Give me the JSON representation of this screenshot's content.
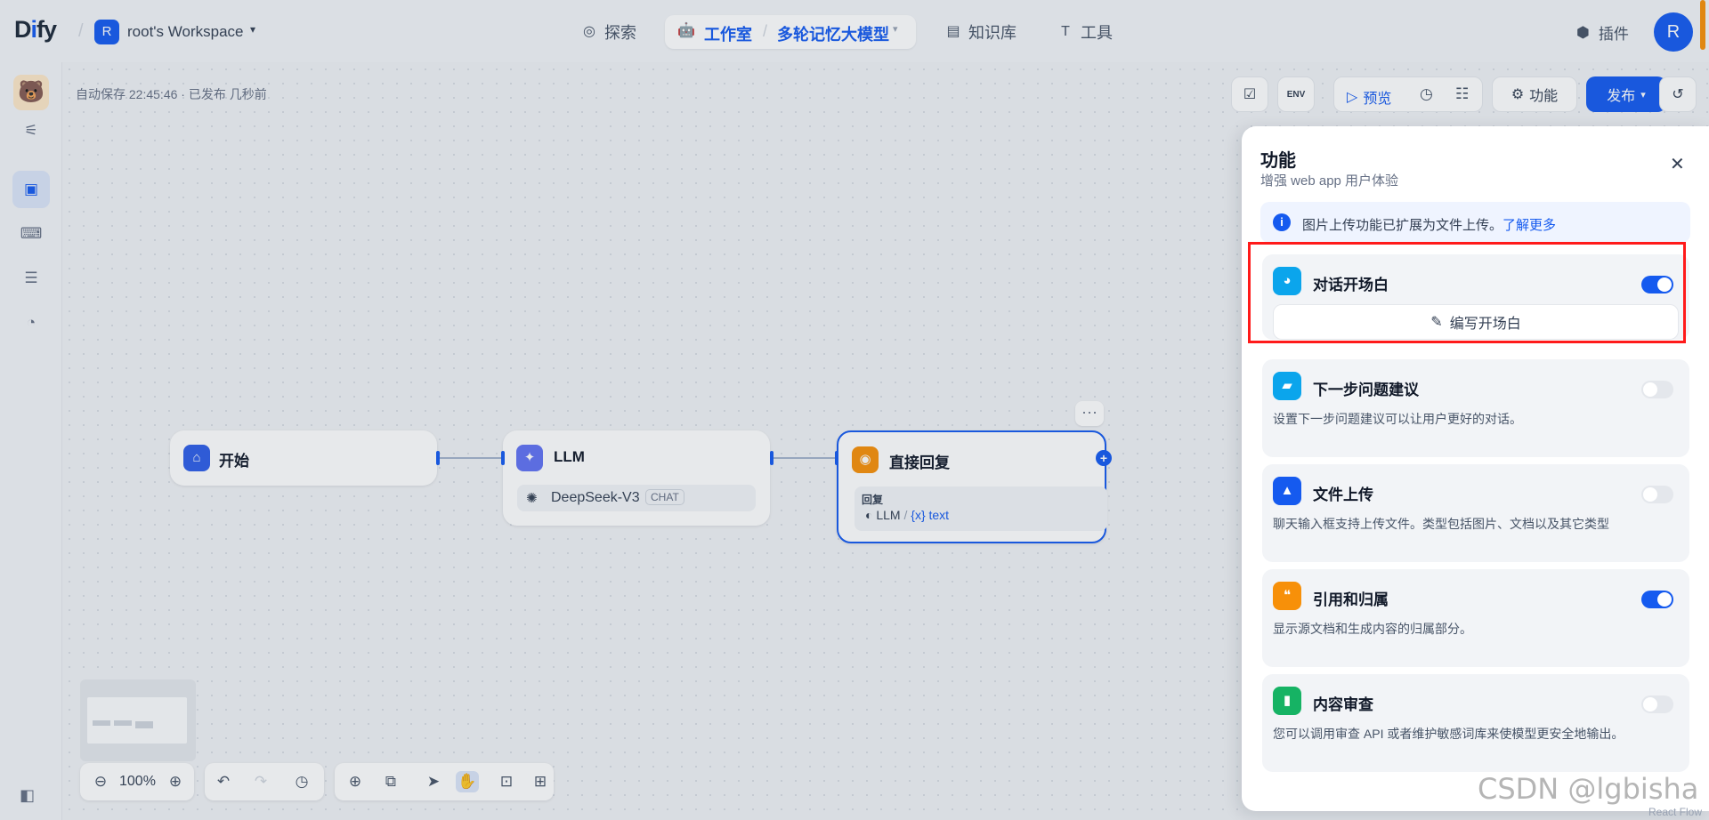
{
  "header": {
    "logo_main": "D",
    "logo_i": "i",
    "logo_rest": "fy",
    "workspace_initial": "R",
    "workspace_name": "root's Workspace",
    "nav": {
      "explore": "探索",
      "studio": "工作室",
      "app_name": "多轮记忆大模型",
      "knowledge": "知识库",
      "tools": "工具"
    },
    "plugins": "插件",
    "user_initial": "R"
  },
  "canvas": {
    "autosave": "自动保存 22:45:46 · 已发布 几秒前",
    "toolbar": {
      "preview": "预览",
      "features": "功能",
      "publish": "发布",
      "env": "ENV"
    },
    "zoom": "100%"
  },
  "nodes": {
    "start": {
      "title": "开始"
    },
    "llm": {
      "title": "LLM",
      "model": "DeepSeek-V3",
      "mode_tag": "CHAT"
    },
    "answer": {
      "title": "直接回复",
      "reply_label": "回复",
      "var_node": "LLM",
      "var_sep": "/",
      "var_name": "{x} text"
    }
  },
  "panel": {
    "title": "功能",
    "subtitle": "增强 web app 用户体验",
    "info": "图片上传功能已扩展为文件上传。",
    "info_link": "了解更多",
    "features": [
      {
        "title": "对话开场白",
        "enabled": true,
        "action": "编写开场白"
      },
      {
        "title": "下一步问题建议",
        "enabled": false,
        "desc": "设置下一步问题建议可以让用户更好的对话。"
      },
      {
        "title": "文件上传",
        "enabled": false,
        "desc": "聊天输入框支持上传文件。类型包括图片、文档以及其它类型"
      },
      {
        "title": "引用和归属",
        "enabled": true,
        "desc": "显示源文档和生成内容的归属部分。"
      },
      {
        "title": "内容审查",
        "enabled": false,
        "desc": "您可以调用审查 API 或者维护敏感词库来使模型更安全地输出。"
      }
    ]
  },
  "watermark": "CSDN @lgbisha",
  "corner_text": "React Flow",
  "colors": {
    "primary": "#155aef",
    "start_icon": "#2e5ee8",
    "llm_icon": "#6172f3",
    "answer_icon": "#f79009",
    "highlight": "#ff1a1a"
  }
}
